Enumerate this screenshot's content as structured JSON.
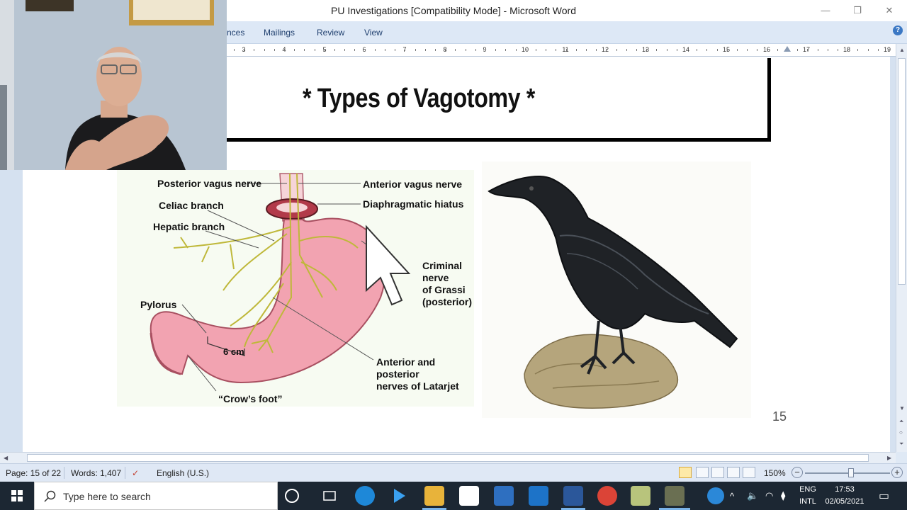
{
  "window": {
    "title": "PU Investigations [Compatibility Mode] - Microsoft Word",
    "minimize_glyph": "—",
    "restore_glyph": "❐",
    "close_glyph": "✕"
  },
  "ribbon": {
    "tabs": [
      "nces",
      "Mailings",
      "Review",
      "View"
    ],
    "help_glyph": "?"
  },
  "ruler": {
    "numbers": [
      "3",
      "4",
      "5",
      "6",
      "7",
      "8",
      "9",
      "10",
      "11",
      "12",
      "13",
      "14",
      "15",
      "16",
      "17",
      "18",
      "19"
    ]
  },
  "slide": {
    "heading": "* Types of Vagotomy *",
    "page_number": "15"
  },
  "diagram": {
    "labels": {
      "posterior_vagus": "Posterior vagus nerve",
      "anterior_vagus": "Anterior vagus nerve",
      "celiac": "Celiac branch",
      "diaphragmatic": "Diaphragmatic hiatus",
      "hepatic": "Hepatic branch",
      "criminal": "Criminal nerve\nof Grassi\n(posterior)",
      "pylorus": "Pylorus",
      "six_cm": "6 cm",
      "latarjet": "Anterior and posterior\nnerves of Latarjet",
      "crows_foot": "“Crow’s foot”"
    }
  },
  "status": {
    "page": "Page: 15 of 22",
    "words": "Words: 1,407",
    "language": "English (U.S.)",
    "zoom": "150%",
    "zoom_minus": "−",
    "zoom_plus": "+"
  },
  "taskbar": {
    "search_placeholder": "Type here to search",
    "lang_top": "ENG",
    "lang_bottom": "INTL",
    "time": "17:53",
    "date": "02/05/2021"
  },
  "colors": {
    "ribbon_bg": "#dde8f6",
    "taskbar_bg": "#1c2733",
    "stomach_pink": "#f2a3b1",
    "nerve_yellow": "#d9d46a"
  }
}
